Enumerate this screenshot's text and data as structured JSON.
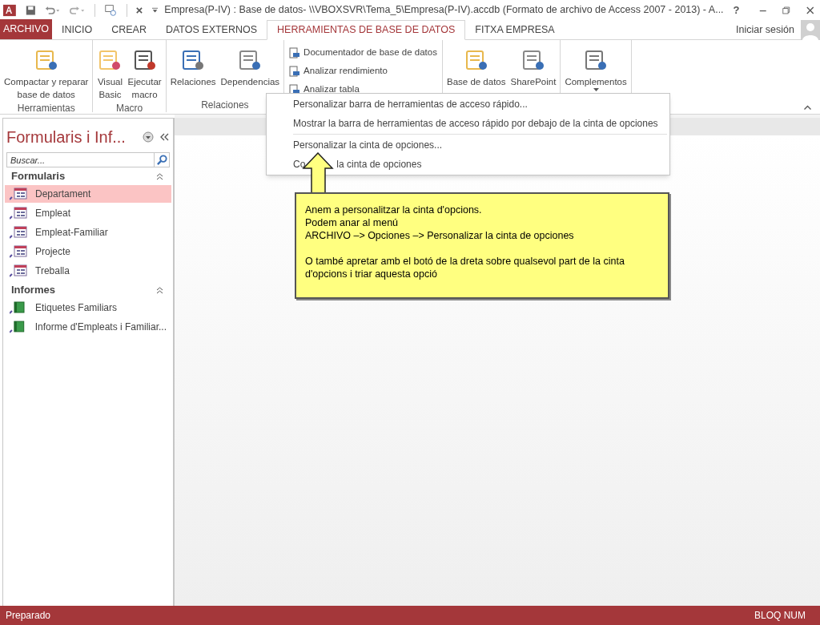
{
  "title_bar": {
    "title": "Empresa(P-IV) : Base de datos- \\\\VBOXSVR\\Tema_5\\Empresa(P-IV).accdb (Formato de archivo de Access 2007 - 2013) - A...",
    "help": "?"
  },
  "tabs": [
    {
      "label": "ARCHIVO",
      "kind": "file",
      "selected": false
    },
    {
      "label": "INICIO",
      "kind": "tab",
      "selected": false
    },
    {
      "label": "CREAR",
      "kind": "tab",
      "selected": false
    },
    {
      "label": "DATOS EXTERNOS",
      "kind": "tab",
      "selected": false
    },
    {
      "label": "HERRAMIENTAS DE BASE DE DATOS",
      "kind": "tab",
      "selected": true
    },
    {
      "label": "FITXA EMPRESA",
      "kind": "tab",
      "selected": false
    }
  ],
  "account": "Iniciar sesión",
  "ribbon_groups": [
    {
      "label": "Herramientas",
      "buttons": [
        {
          "kind": "large",
          "lines": [
            "Compactar y reparar",
            "base de datos"
          ]
        }
      ]
    },
    {
      "label": "Macro",
      "buttons": [
        {
          "kind": "large",
          "lines": [
            "Visual",
            "Basic"
          ]
        },
        {
          "kind": "large",
          "lines": [
            "Ejecutar",
            "macro"
          ]
        }
      ]
    },
    {
      "label": "Relaciones",
      "buttons": [
        {
          "kind": "large",
          "lines": [
            "Relaciones"
          ]
        },
        {
          "kind": "large",
          "lines": [
            "Dependencias"
          ]
        }
      ]
    },
    {
      "buttons": [
        {
          "kind": "small",
          "lines": [
            "Documentador de base de datos"
          ]
        },
        {
          "kind": "small",
          "lines": [
            "Analizar rendimiento"
          ]
        },
        {
          "kind": "small",
          "lines": [
            "Analizar tabla"
          ]
        }
      ]
    },
    {
      "buttons": [
        {
          "kind": "large",
          "lines": [
            "Base de datos"
          ]
        },
        {
          "kind": "large",
          "lines": [
            "SharePoint"
          ]
        }
      ]
    },
    {
      "buttons": [
        {
          "kind": "menu",
          "lines": [
            "Complementos"
          ]
        }
      ]
    }
  ],
  "nav": {
    "title": "Formularis i Inf...",
    "search": {
      "placeholder": "Buscar..."
    },
    "sections": [
      {
        "label": "Formularis",
        "items": [
          {
            "label": "Departament",
            "kind": "form",
            "selected": true
          },
          {
            "label": "Empleat",
            "kind": "form",
            "selected": false
          },
          {
            "label": "Empleat-Familiar",
            "kind": "form",
            "selected": false
          },
          {
            "label": "Projecte",
            "kind": "form",
            "selected": false
          },
          {
            "label": "Treballa",
            "kind": "form",
            "selected": false
          }
        ]
      },
      {
        "label": "Informes",
        "items": [
          {
            "label": "Etiquetes Familiars",
            "kind": "report",
            "selected": false
          },
          {
            "label": "Informe d'Empleats i Familiar...",
            "kind": "report",
            "selected": false
          }
        ]
      }
    ]
  },
  "context_menu": [
    {
      "kind": "item",
      "text": "Personalizar barra de herramientas de acceso rápido..."
    },
    {
      "kind": "item",
      "text": "Mostrar la barra de herramientas de acceso rápido por debajo de la cinta de opciones"
    },
    {
      "kind": "separator"
    },
    {
      "kind": "item",
      "text": "Personalizar la cinta de opciones..."
    },
    {
      "kind": "split",
      "parts": [
        "Co",
        "la cinta de opciones"
      ]
    }
  ],
  "callout": {
    "paragraphs": [
      [
        "Anem a personalitzar la cinta d'opcions.",
        "Podem anar al menú",
        "ARCHIVO –> Opciones –> Personalizar la cinta de opciones"
      ],
      [
        "O també apretar amb el botó de la dreta sobre qualsevol part de la cinta d'opcions i triar aquesta opció"
      ]
    ]
  },
  "status_bar": {
    "left": "Preparado",
    "right": "BLOQ NUM"
  }
}
